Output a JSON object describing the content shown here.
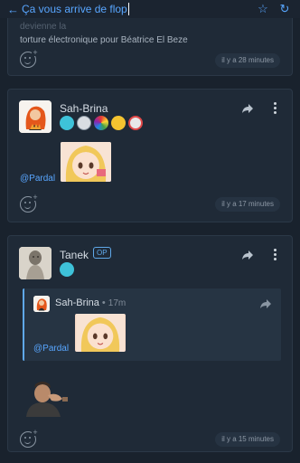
{
  "topbar": {
    "back_icon": "arrow-left-icon",
    "title": "Ça vous arrive de flop",
    "star_icon": "star-icon",
    "refresh_icon": "refresh-icon"
  },
  "posts": [
    {
      "text_faded": "Ce n'est sûrement qu'une question de temps avant que ça devienne la",
      "text": "torture électronique pour Béatrice El Beze",
      "timestamp": "il y a 28 minutes"
    },
    {
      "username": "Sah-Brina",
      "mention": "@Pardal",
      "timestamp": "il y a 17 minutes"
    },
    {
      "username": "Tanek",
      "op_badge": "OP",
      "quote": {
        "username": "Sah-Brina",
        "separator": "•",
        "time": "17m",
        "mention": "@Pardal"
      },
      "timestamp": "il y a 15 minutes"
    }
  ],
  "colors": {
    "background": "#19222d",
    "card": "#1f2a37",
    "accent": "#58a6ff"
  }
}
